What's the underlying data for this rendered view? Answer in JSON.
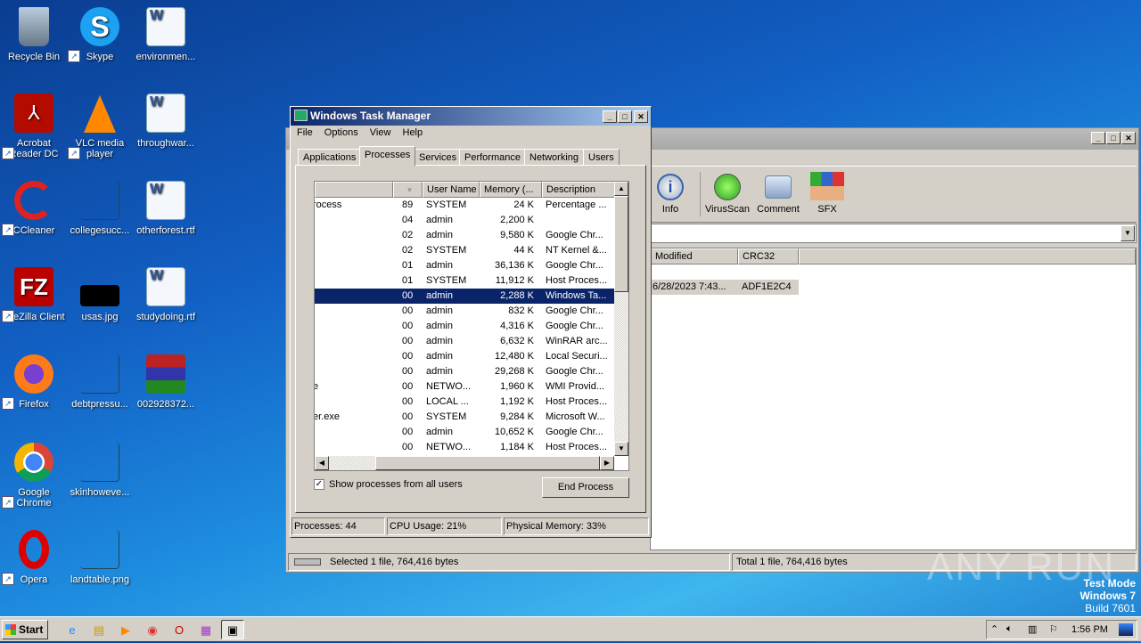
{
  "desktop": {
    "icons": [
      {
        "label": "Recycle Bin",
        "icon": "recycle-bin-icon"
      },
      {
        "label": "Skype",
        "icon": "skype-icon"
      },
      {
        "label": "environmen...",
        "icon": "word-doc-icon"
      },
      {
        "label": "Acrobat Reader DC",
        "icon": "acrobat-icon"
      },
      {
        "label": "VLC media player",
        "icon": "vlc-icon"
      },
      {
        "label": "throughwar...",
        "icon": "word-doc-icon"
      },
      {
        "label": "CCleaner",
        "icon": "ccleaner-icon"
      },
      {
        "label": "collegesucc...",
        "icon": "blank-file-icon"
      },
      {
        "label": "otherforest.rtf",
        "icon": "word-doc-icon"
      },
      {
        "label": "FileZilla Client",
        "icon": "filezilla-icon"
      },
      {
        "label": "usas.jpg",
        "icon": "image-file-icon"
      },
      {
        "label": "studydoing.rtf",
        "icon": "word-doc-icon"
      },
      {
        "label": "Firefox",
        "icon": "firefox-icon"
      },
      {
        "label": "debtpressu...",
        "icon": "blank-file-icon"
      },
      {
        "label": "002928372...",
        "icon": "winrar-archive-icon"
      },
      {
        "label": "Google Chrome",
        "icon": "chrome-icon"
      },
      {
        "label": "skinhoweve...",
        "icon": "blank-file-icon"
      },
      {
        "label": "Opera",
        "icon": "opera-icon"
      },
      {
        "label": "landtable.png",
        "icon": "blank-file-icon"
      }
    ]
  },
  "winrar": {
    "toolbar": [
      {
        "label": "Info"
      },
      {
        "label": "VirusScan"
      },
      {
        "label": "Comment"
      },
      {
        "label": "SFX"
      }
    ],
    "columns": [
      "Modified",
      "CRC32"
    ],
    "row": {
      "modified": "6/28/2023 7:43...",
      "crc": "ADF1E2C4"
    },
    "status_left": "Selected 1 file, 764,416 bytes",
    "status_right": "Total 1 file, 764,416 bytes"
  },
  "taskmgr": {
    "title": "Windows Task Manager",
    "menu": [
      "File",
      "Options",
      "View",
      "Help"
    ],
    "tabs": [
      "Applications",
      "Processes",
      "Services",
      "Performance",
      "Networking",
      "Users"
    ],
    "active_tab": "Processes",
    "columns": [
      "",
      "",
      "User Name",
      "Memory (...",
      "Description"
    ],
    "rows": [
      {
        "name": "rocess",
        "cpu": "89",
        "user": "SYSTEM",
        "mem": "24 K",
        "desc": "Percentage ..."
      },
      {
        "name": "",
        "cpu": "04",
        "user": "admin",
        "mem": "2,200 K",
        "desc": ""
      },
      {
        "name": "",
        "cpu": "02",
        "user": "admin",
        "mem": "9,580 K",
        "desc": "Google Chr..."
      },
      {
        "name": "",
        "cpu": "02",
        "user": "SYSTEM",
        "mem": "44 K",
        "desc": "NT Kernel &..."
      },
      {
        "name": "",
        "cpu": "01",
        "user": "admin",
        "mem": "36,136 K",
        "desc": "Google Chr..."
      },
      {
        "name": "",
        "cpu": "01",
        "user": "SYSTEM",
        "mem": "11,912 K",
        "desc": "Host Proces..."
      },
      {
        "name": "",
        "cpu": "00",
        "user": "admin",
        "mem": "2,288 K",
        "desc": "Windows Ta...",
        "selected": true
      },
      {
        "name": "",
        "cpu": "00",
        "user": "admin",
        "mem": "832 K",
        "desc": "Google Chr..."
      },
      {
        "name": "",
        "cpu": "00",
        "user": "admin",
        "mem": "4,316 K",
        "desc": "Google Chr..."
      },
      {
        "name": "",
        "cpu": "00",
        "user": "admin",
        "mem": "6,632 K",
        "desc": "WinRAR arc..."
      },
      {
        "name": "",
        "cpu": "00",
        "user": "admin",
        "mem": "12,480 K",
        "desc": "Local Securi..."
      },
      {
        "name": "",
        "cpu": "00",
        "user": "admin",
        "mem": "29,268 K",
        "desc": "Google Chr..."
      },
      {
        "name": "e",
        "cpu": "00",
        "user": "NETWO...",
        "mem": "1,960 K",
        "desc": "WMI Provid..."
      },
      {
        "name": "",
        "cpu": "00",
        "user": "LOCAL ...",
        "mem": "1,192 K",
        "desc": "Host Proces..."
      },
      {
        "name": "er.exe",
        "cpu": "00",
        "user": "SYSTEM",
        "mem": "9,284 K",
        "desc": "Microsoft W..."
      },
      {
        "name": "",
        "cpu": "00",
        "user": "admin",
        "mem": "10,652 K",
        "desc": "Google Chr..."
      },
      {
        "name": "",
        "cpu": "00",
        "user": "NETWO...",
        "mem": "1,184 K",
        "desc": "Host Proces..."
      }
    ],
    "show_all_label": "Show processes from all users",
    "show_all_checked": true,
    "end_process_label": "End Process",
    "status": {
      "processes": "Processes: 44",
      "cpu": "CPU Usage: 21%",
      "memory": "Physical Memory: 33%"
    }
  },
  "watermark": {
    "text": "ANY RUN",
    "line1": "Test Mode",
    "line2": "Windows 7",
    "line3": "Build 7601"
  },
  "taskbar": {
    "start_label": "Start",
    "clock": "1:56 PM"
  }
}
